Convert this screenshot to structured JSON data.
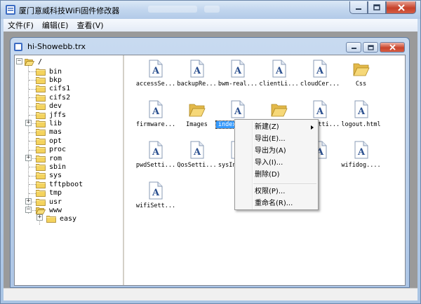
{
  "window": {
    "title": "厦门意威科技WiFi固件修改器"
  },
  "menubar": {
    "items": [
      {
        "label": "文件(F)"
      },
      {
        "label": "编辑(E)"
      },
      {
        "label": "查看(V)"
      }
    ]
  },
  "child_window": {
    "title": "hi-Showebb.trx"
  },
  "tree": {
    "root": "/",
    "items": [
      {
        "label": "bin"
      },
      {
        "label": "bkp"
      },
      {
        "label": "cifs1"
      },
      {
        "label": "cifs2"
      },
      {
        "label": "dev"
      },
      {
        "label": "jffs"
      },
      {
        "label": "lib"
      },
      {
        "label": "mas"
      },
      {
        "label": "opt"
      },
      {
        "label": "proc"
      },
      {
        "label": "rom"
      },
      {
        "label": "sbin"
      },
      {
        "label": "sys"
      },
      {
        "label": "tftpboot"
      },
      {
        "label": "tmp"
      },
      {
        "label": "usr"
      },
      {
        "label": "www"
      }
    ],
    "subitem": "easy"
  },
  "files": {
    "items": [
      {
        "label": "accessSe...",
        "icon": "document-icon"
      },
      {
        "label": "backupRe...",
        "icon": "document-icon"
      },
      {
        "label": "bwm-real...",
        "icon": "document-icon"
      },
      {
        "label": "clientLi...",
        "icon": "document-icon"
      },
      {
        "label": "cloudCer...",
        "icon": "document-icon"
      },
      {
        "label": "Css",
        "icon": "folder-icon"
      },
      {
        "label": "firmware...",
        "icon": "document-icon"
      },
      {
        "label": "Images",
        "icon": "folder-icon"
      },
      {
        "label": "index.ht...",
        "icon": "document-icon"
      },
      {
        "label": "Js",
        "icon": "folder-icon"
      },
      {
        "label": "lanSetti...",
        "icon": "document-icon"
      },
      {
        "label": "logout.html",
        "icon": "document-icon"
      },
      {
        "label": "pwdSetti...",
        "icon": "document-icon"
      },
      {
        "label": "QosSetti...",
        "icon": "document-icon"
      },
      {
        "label": "sysInfo....",
        "icon": "document-icon"
      },
      {
        "label": "",
        "icon": "document-icon"
      },
      {
        "label": "",
        "icon": "document-icon"
      },
      {
        "label": "wifidog....",
        "icon": "document-icon"
      },
      {
        "label": "wifiSett...",
        "icon": "document-icon"
      }
    ]
  },
  "context_menu": {
    "items": [
      {
        "label": "新建(Z)"
      },
      {
        "label": "导出(E)..."
      },
      {
        "label": "导出为(A)"
      },
      {
        "label": "导入(I)..."
      },
      {
        "label": "删除(D)"
      },
      {
        "label": "权限(P)..."
      },
      {
        "label": "重命名(R)..."
      }
    ]
  },
  "colors": {
    "selection": "#3399ff",
    "folder": "#f2d05b",
    "doc_letter": "#2a4f8f"
  }
}
